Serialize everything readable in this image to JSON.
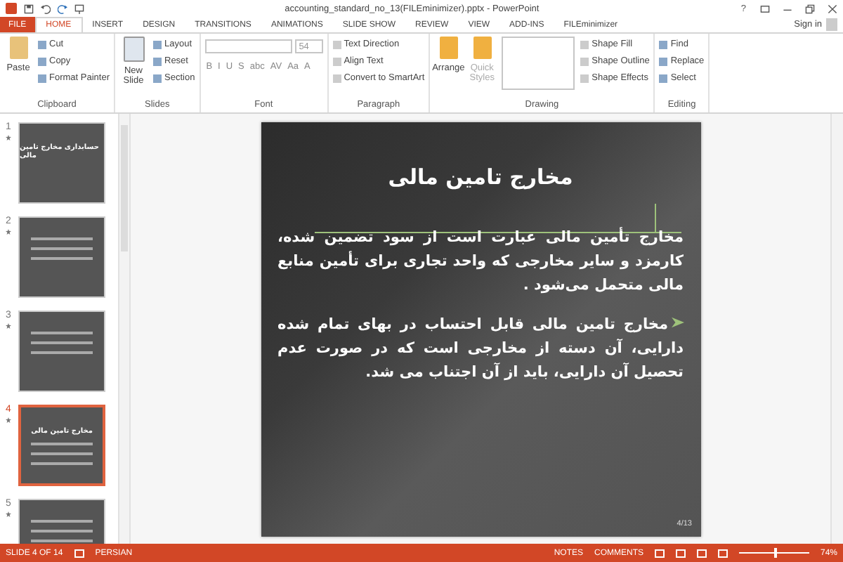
{
  "window": {
    "title": "accounting_standard_no_13(FILEminimizer).pptx - PowerPoint",
    "help": "?",
    "sign_in": "Sign in"
  },
  "tabs": [
    {
      "label": "FILE",
      "kind": "file",
      "selected": false
    },
    {
      "label": "HOME",
      "kind": "tab",
      "selected": true
    },
    {
      "label": "INSERT",
      "kind": "tab",
      "selected": false
    },
    {
      "label": "DESIGN",
      "kind": "tab",
      "selected": false
    },
    {
      "label": "TRANSITIONS",
      "kind": "tab",
      "selected": false
    },
    {
      "label": "ANIMATIONS",
      "kind": "tab",
      "selected": false
    },
    {
      "label": "SLIDE SHOW",
      "kind": "tab",
      "selected": false
    },
    {
      "label": "REVIEW",
      "kind": "tab",
      "selected": false
    },
    {
      "label": "VIEW",
      "kind": "tab",
      "selected": false
    },
    {
      "label": "ADD-INS",
      "kind": "tab",
      "selected": false
    },
    {
      "label": "FILEminimizer",
      "kind": "tab",
      "selected": false
    }
  ],
  "ribbon": {
    "groups": [
      {
        "label": "Clipboard",
        "large": [
          {
            "label": "Paste",
            "disabled": false
          }
        ],
        "small": [
          {
            "label": "Cut",
            "disabled": false
          },
          {
            "label": "Copy",
            "disabled": false
          },
          {
            "label": "Format Painter",
            "disabled": false
          }
        ]
      },
      {
        "label": "Slides",
        "large": [
          {
            "label": "New Slide",
            "disabled": false
          }
        ],
        "small": [
          {
            "label": "Layout",
            "disabled": false
          },
          {
            "label": "Reset",
            "disabled": false
          },
          {
            "label": "Section",
            "disabled": false
          }
        ]
      },
      {
        "label": "Font",
        "font_size": "54",
        "format_buttons": [
          "B",
          "I",
          "U",
          "S",
          "abc",
          "AV",
          "Aa",
          "A"
        ]
      },
      {
        "label": "Paragraph",
        "small": [
          {
            "label": "Text Direction",
            "disabled": true
          },
          {
            "label": "Align Text",
            "disabled": true
          },
          {
            "label": "Convert to SmartArt",
            "disabled": true
          }
        ]
      },
      {
        "label": "Drawing",
        "large": [
          {
            "label": "Arrange",
            "disabled": false
          },
          {
            "label": "Quick Styles",
            "disabled": true
          }
        ],
        "small": [
          {
            "label": "Shape Fill",
            "disabled": true
          },
          {
            "label": "Shape Outline",
            "disabled": true
          },
          {
            "label": "Shape Effects",
            "disabled": true
          }
        ]
      },
      {
        "label": "Editing",
        "small": [
          {
            "label": "Find",
            "disabled": false
          },
          {
            "label": "Replace",
            "disabled": false
          },
          {
            "label": "Select",
            "disabled": false
          }
        ]
      }
    ]
  },
  "thumbnails": [
    {
      "number": "1",
      "selected": false,
      "title": "حسابداری مخارج تامین مالی"
    },
    {
      "number": "2",
      "selected": false
    },
    {
      "number": "3",
      "selected": false
    },
    {
      "number": "4",
      "selected": true,
      "title": "مخارج تامین مالی"
    },
    {
      "number": "5",
      "selected": false
    }
  ],
  "slide": {
    "title": "مخارج تامین مالی",
    "paragraphs": [
      {
        "text": "مخارج تأمین مالی عبارت است از سود تضمین شده، کارمزد و سایر مخارجی که واحد تجاری برای تأمین منابع مالی متحمل می‌شود .",
        "bullet": false
      },
      {
        "text": "مخارج تامین مالی قابل احتساب در بهای تمام شده دارایی، آن دسته از مخارجی است که در صورت عدم تحصیل آن دارایی، باید از آن اجتناب می شد.",
        "bullet": true
      }
    ],
    "page": "4/13"
  },
  "status_bar": {
    "slide": "SLIDE 4 OF 14",
    "language": "PERSIAN",
    "notes": "NOTES",
    "comments": "COMMENTS",
    "zoom": "74%",
    "zoom_slider": {
      "level": 0.5
    }
  }
}
